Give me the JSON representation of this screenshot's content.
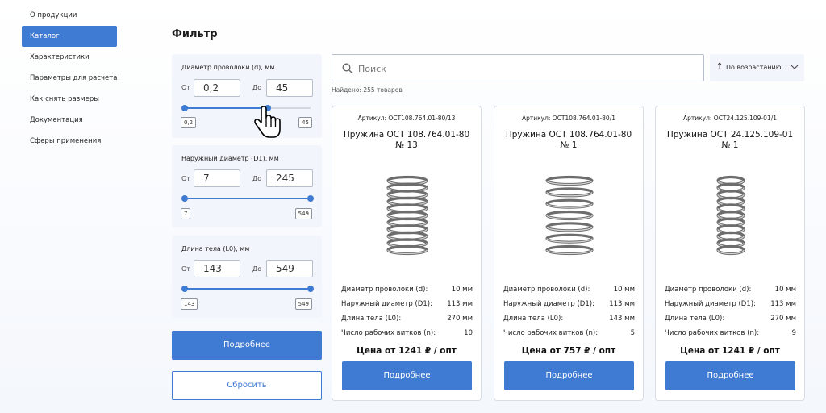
{
  "sidebar": {
    "items": [
      {
        "label": "О продукции"
      },
      {
        "label": "Каталог",
        "active": true
      },
      {
        "label": "Характеристики"
      },
      {
        "label": "Параметры для расчета"
      },
      {
        "label": "Как снять размеры"
      },
      {
        "label": "Документация"
      },
      {
        "label": "Сферы применения"
      }
    ]
  },
  "filter": {
    "title": "Фильтр",
    "from_label": "От",
    "to_label": "До",
    "groups": [
      {
        "title": "Диаметр проволоки (d), мм",
        "from": "0,2",
        "to": "45",
        "min": "0,2",
        "max": "45",
        "range_min": 0.2,
        "range_max": 45,
        "selected_from": 0.2,
        "selected_to": 29.7
      },
      {
        "title": "Наружный диаметр (D1), мм",
        "from": "7",
        "to": "245",
        "min": "7",
        "max": "549",
        "range_min": 7,
        "range_max": 549,
        "selected_from": 7,
        "selected_to": 549
      },
      {
        "title": "Длина тела (L0), мм",
        "from": "143",
        "to": "549",
        "min": "143",
        "max": "549",
        "range_min": 143,
        "range_max": 549,
        "selected_from": 143,
        "selected_to": 549
      }
    ],
    "apply_label": "Подробнее",
    "reset_label": "Сбросить"
  },
  "search": {
    "placeholder": "Поиск",
    "value": ""
  },
  "sort": {
    "label": "По возрастанию..."
  },
  "found": "Найдено:  255 товаров",
  "cards": [
    {
      "article": "Артикул:  ОСТ108.764.01-80/13",
      "name_line1": "Пружина ОСТ 108.764.01-80",
      "name_line2": "№ 13",
      "specs": [
        {
          "k": "Диаметр проволоки (d):",
          "v": "10 мм"
        },
        {
          "k": "Наружный диаметр (D1):",
          "v": "113 мм"
        },
        {
          "k": "Длина тела (L0):",
          "v": "270 мм"
        },
        {
          "k": "Число рабочих витков (n):",
          "v": "10"
        }
      ],
      "price": "Цена от 1241 ₽ / опт",
      "button": "Подробнее"
    },
    {
      "article": "Артикул:  ОСТ108.764.01-80/1",
      "name_line1": "Пружина ОСТ 108.764.01-80",
      "name_line2": "№ 1",
      "specs": [
        {
          "k": "Диаметр проволоки (d):",
          "v": "10 мм"
        },
        {
          "k": "Наружный диаметр (D1):",
          "v": "113 мм"
        },
        {
          "k": "Длина тела (L0):",
          "v": "143 мм"
        },
        {
          "k": "Число рабочих витков (n):",
          "v": "5"
        }
      ],
      "price": "Цена от 757 ₽ / опт",
      "button": "Подробнее"
    },
    {
      "article": "Артикул:  ОСТ24.125.109-01/1",
      "name_line1": "Пружина ОСТ 24.125.109-01",
      "name_line2": "№ 1",
      "specs": [
        {
          "k": "Диаметр проволоки (d):",
          "v": "10 мм"
        },
        {
          "k": "Наружный диаметр (D1):",
          "v": "113 мм"
        },
        {
          "k": "Длина тела (L0):",
          "v": "270 мм"
        },
        {
          "k": "Число рабочих витков (n):",
          "v": "9"
        }
      ],
      "price": "Цена от 1241 ₽ / опт",
      "button": "Подробнее"
    }
  ],
  "colors": {
    "accent": "#3f7ad3",
    "panel_bg": "#f2f5fb"
  }
}
